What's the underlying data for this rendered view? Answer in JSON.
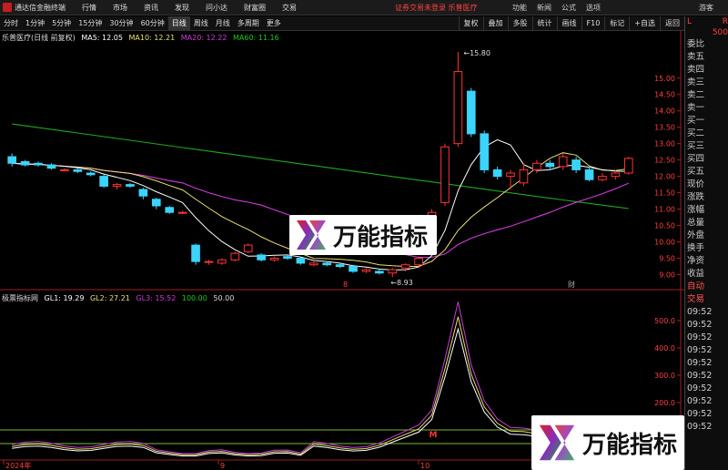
{
  "titlebar": {
    "app_name": "通达信金融终端",
    "menus": [
      "行情",
      "市场",
      "资讯",
      "发现",
      "问小达",
      "财富圈",
      "交易"
    ],
    "warning": "证券交易未登录  乐普医疗",
    "right_items": [
      "功能",
      "新闻",
      "公式",
      "选项"
    ],
    "user": "游客"
  },
  "toolbar": {
    "periods": [
      "分时",
      "1分钟",
      "5分钟",
      "15分钟",
      "30分钟",
      "60分钟",
      "日线",
      "周线",
      "月线",
      "多周期",
      "更多"
    ],
    "active": "日线",
    "tools": [
      "复权",
      "叠加",
      "多股",
      "统计",
      "画线",
      "F10",
      "标记",
      "+自选",
      "返回"
    ]
  },
  "main_legend": {
    "name": "乐普医疗(日线 前复权)",
    "ma5": "MA5: 12.05",
    "ma10": "MA10: 12.21",
    "ma20": "MA20: 12.22",
    "ma60": "MA60: 11.16"
  },
  "sub_legend": {
    "name": "极票指标网",
    "gl1": "GL1: 19.29",
    "gl2": "GL2: 27.21",
    "gl3": "GL3: 15.52",
    "v100": "100.00",
    "v50": "50.00"
  },
  "price_axis": [
    "15.00",
    "14.50",
    "14.00",
    "13.50",
    "13.00",
    "12.50",
    "12.00",
    "11.50",
    "11.00",
    "10.50",
    "10.00",
    "9.50",
    "9.00"
  ],
  "ind_axis": [
    "500.0",
    "400.0",
    "300.0",
    "200.0",
    "100.0",
    "50.0"
  ],
  "annotations": {
    "high": "15.80",
    "low": "8.93",
    "label_8": "8",
    "label_cai": "财"
  },
  "date_axis": [
    "2024年",
    "9",
    "10"
  ],
  "right_panel": {
    "header_left": "L",
    "header_right": "R",
    "sub": "500",
    "items": [
      "委比",
      "卖五",
      "卖四",
      "卖三",
      "卖二",
      "卖一",
      "买一",
      "买二",
      "买三",
      "买四",
      "买五",
      "现价",
      "涨跌",
      "涨幅",
      "总量",
      "外盘",
      "换手",
      "净资",
      "收益"
    ],
    "items2": [
      "自动",
      "交易",
      "09:52",
      "09:52",
      "09:52",
      "09:52",
      "09:52",
      "09:52",
      "09:52",
      "09:52",
      "09:52",
      "09:52"
    ]
  },
  "watermark": "万能指标",
  "colors": {
    "up": "#ff3333",
    "down": "#3ad4ff",
    "ma5": "#ffffff",
    "ma10": "#e8e070",
    "ma20": "#ce3cd8",
    "ma60": "#1ea81e"
  },
  "chart_data": {
    "type": "candlestick",
    "price_range": [
      8.7,
      16.0
    ],
    "candles": [
      [
        12.6,
        12.4,
        12.7,
        12.3
      ],
      [
        12.45,
        12.35,
        12.5,
        12.3
      ],
      [
        12.4,
        12.35,
        12.45,
        12.3
      ],
      [
        12.35,
        12.25,
        12.4,
        12.2
      ],
      [
        12.2,
        12.2,
        12.25,
        12.15
      ],
      [
        12.2,
        12.15,
        12.25,
        12.1
      ],
      [
        12.1,
        12.05,
        12.15,
        12.0
      ],
      [
        12.0,
        11.7,
        12.05,
        11.65
      ],
      [
        11.7,
        11.75,
        11.8,
        11.6
      ],
      [
        11.75,
        11.7,
        11.8,
        11.65
      ],
      [
        11.6,
        11.4,
        11.65,
        11.3
      ],
      [
        11.3,
        11.1,
        11.35,
        11.0
      ],
      [
        11.05,
        10.9,
        11.1,
        10.85
      ],
      [
        10.9,
        10.9,
        10.95,
        10.85
      ],
      [
        9.9,
        9.4,
        9.95,
        9.3
      ],
      [
        9.4,
        9.4,
        9.45,
        9.3
      ],
      [
        9.35,
        9.45,
        9.5,
        9.3
      ],
      [
        9.45,
        9.65,
        9.7,
        9.4
      ],
      [
        9.7,
        9.9,
        9.95,
        9.65
      ],
      [
        9.6,
        9.45,
        9.65,
        9.4
      ],
      [
        9.45,
        9.5,
        9.55,
        9.4
      ],
      [
        9.55,
        9.5,
        9.6,
        9.45
      ],
      [
        9.5,
        9.35,
        9.55,
        9.3
      ],
      [
        9.3,
        9.35,
        9.4,
        9.25
      ],
      [
        9.35,
        9.3,
        9.4,
        9.25
      ],
      [
        9.3,
        9.25,
        9.35,
        9.2
      ],
      [
        9.25,
        9.1,
        9.3,
        9.05
      ],
      [
        9.1,
        9.15,
        9.2,
        9.05
      ],
      [
        9.1,
        9.05,
        9.15,
        9.0
      ],
      [
        9.05,
        9.15,
        9.2,
        8.93
      ],
      [
        9.2,
        9.3,
        9.35,
        9.1
      ],
      [
        9.3,
        9.5,
        9.55,
        9.2
      ],
      [
        10.3,
        10.9,
        11.0,
        10.2
      ],
      [
        11.2,
        12.9,
        13.0,
        11.1
      ],
      [
        13.0,
        15.2,
        15.8,
        12.9
      ],
      [
        14.6,
        13.3,
        14.7,
        13.2
      ],
      [
        13.3,
        12.2,
        13.4,
        12.1
      ],
      [
        12.2,
        12.0,
        12.3,
        11.9
      ],
      [
        12.0,
        12.1,
        12.2,
        11.6
      ],
      [
        11.8,
        12.2,
        12.4,
        11.7
      ],
      [
        12.2,
        12.4,
        12.5,
        12.1
      ],
      [
        12.4,
        12.3,
        12.5,
        12.2
      ],
      [
        12.3,
        12.6,
        12.7,
        12.2
      ],
      [
        12.5,
        12.2,
        12.6,
        12.1
      ],
      [
        12.2,
        11.9,
        12.3,
        11.85
      ],
      [
        11.9,
        12.0,
        12.1,
        11.85
      ],
      [
        12.0,
        12.1,
        12.2,
        11.9
      ],
      [
        12.1,
        12.55,
        12.6,
        12.05
      ]
    ]
  }
}
